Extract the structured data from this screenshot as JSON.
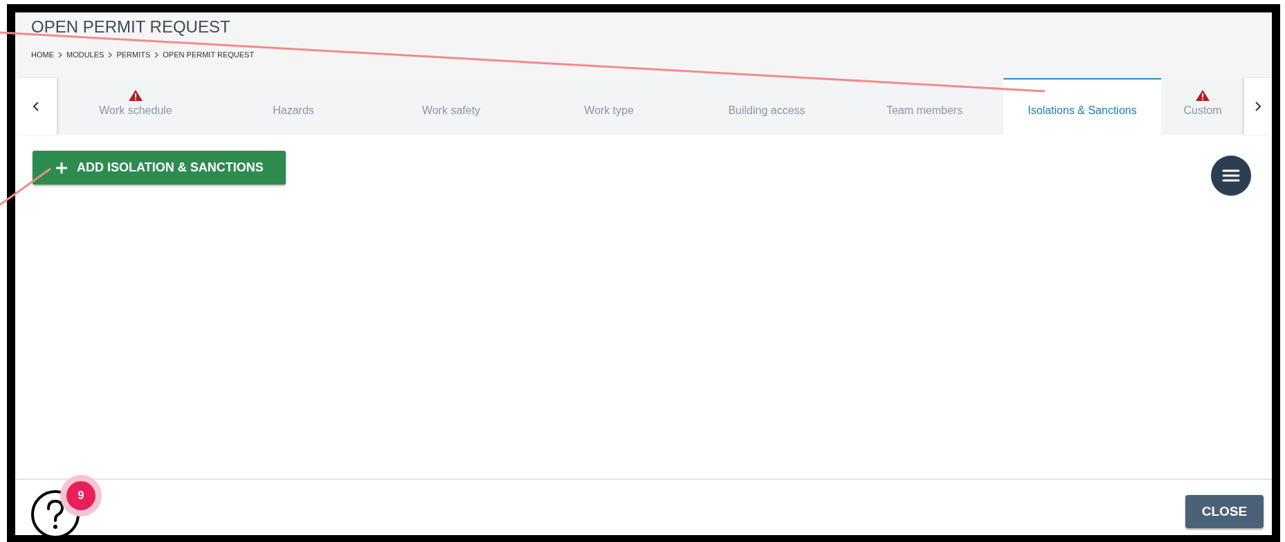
{
  "header": {
    "title": "OPEN PERMIT REQUEST",
    "breadcrumbs": [
      "HOME",
      "MODULES",
      "PERMITS",
      "OPEN PERMIT REQUEST"
    ]
  },
  "tabs": [
    {
      "label": "Work schedule",
      "selected": false,
      "warning": true
    },
    {
      "label": "Hazards",
      "selected": false,
      "warning": false
    },
    {
      "label": "Work safety",
      "selected": false,
      "warning": false
    },
    {
      "label": "Work type",
      "selected": false,
      "warning": false
    },
    {
      "label": "Building access",
      "selected": false,
      "warning": false
    },
    {
      "label": "Team members",
      "selected": false,
      "warning": false
    },
    {
      "label": "Isolations & Sanctions",
      "selected": true,
      "warning": false
    },
    {
      "label": "Custom",
      "selected": false,
      "warning": true
    }
  ],
  "add_button": {
    "label": "ADD ISOLATION & SANCTIONS"
  },
  "help": {
    "badge": "9"
  },
  "close_button": {
    "label": "CLOSE"
  }
}
